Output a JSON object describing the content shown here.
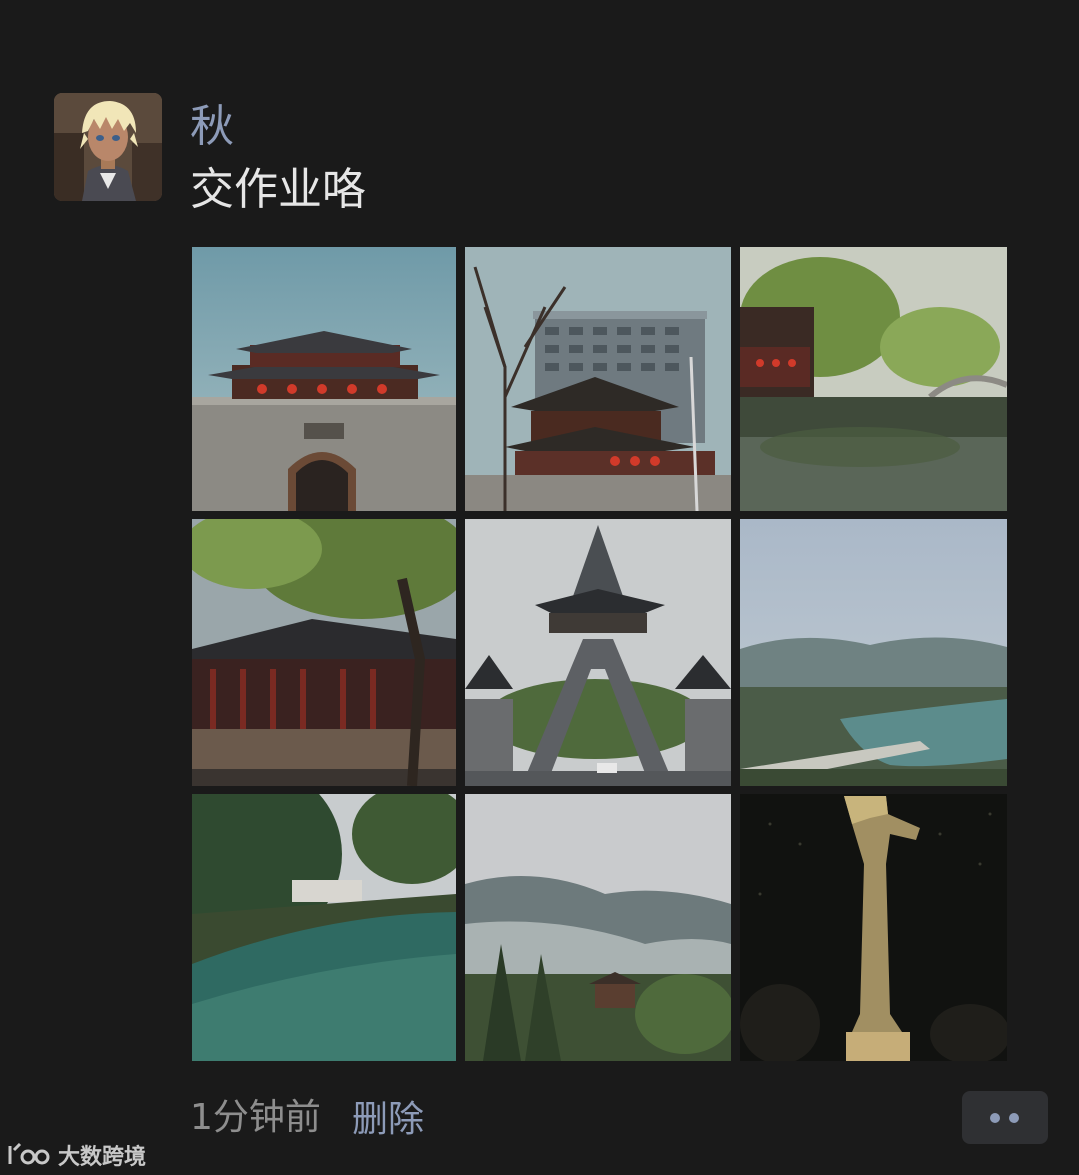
{
  "post": {
    "username": "秋",
    "text": "交作业咯",
    "time": "1分钟前",
    "delete_label": "删除"
  },
  "photos": [
    {
      "name": "photo-city-gate"
    },
    {
      "name": "photo-tower-highrise"
    },
    {
      "name": "photo-willow-pond"
    },
    {
      "name": "photo-temple-tree"
    },
    {
      "name": "photo-triangle-gate"
    },
    {
      "name": "photo-river-valley"
    },
    {
      "name": "photo-green-river"
    },
    {
      "name": "photo-misty-mountains"
    },
    {
      "name": "photo-bronze-statue"
    }
  ],
  "watermark": {
    "text": "大数跨境"
  },
  "colors": {
    "background": "#1a1a1a",
    "username": "#8d9bb8",
    "text": "#e6e6e6",
    "time": "#8e8e8e",
    "link": "#8d9bb8",
    "button_bg": "#2f3033"
  }
}
